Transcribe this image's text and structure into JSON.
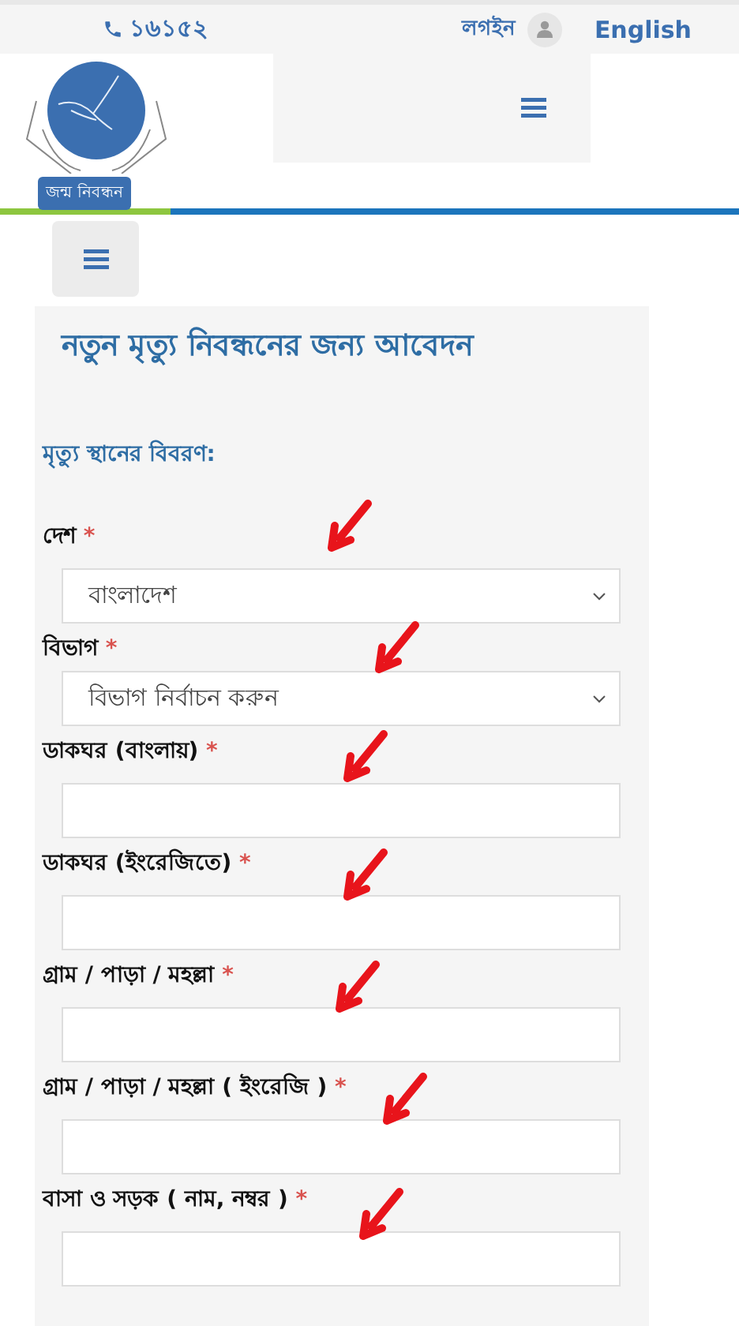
{
  "top_bar": {
    "phone": "১৬১৫২",
    "login": "লগইন",
    "language": "English"
  },
  "header": {
    "logo_text": "জন্ম নিবন্ধন"
  },
  "form": {
    "title": "নতুন মৃত্যু নিবন্ধনের জন্য আবেদন",
    "section": "মৃত্যু স্থানের বিবরণ:",
    "fields": [
      {
        "kind": "select",
        "label": "দেশ",
        "required_mark": "*",
        "value": "বাংলাদেশ"
      },
      {
        "kind": "select",
        "label": "বিভাগ",
        "required_mark": "*",
        "value": "বিভাগ নির্বাচন করুন"
      },
      {
        "kind": "text",
        "label": "ডাকঘর (বাংলায়)",
        "required_mark": "*"
      },
      {
        "kind": "text",
        "label": "ডাকঘর (ইংরেজিতে)",
        "required_mark": "*"
      },
      {
        "kind": "text",
        "label": "গ্রাম / পাড়া / মহল্লা",
        "required_mark": "*"
      },
      {
        "kind": "text",
        "label": "গ্রাম / পাড়া / মহল্লা ( ইংরেজি )",
        "required_mark": "*"
      },
      {
        "kind": "text",
        "label": "বাসা ও সড়ক ( নাম, নম্বর )",
        "required_mark": "*"
      }
    ]
  }
}
